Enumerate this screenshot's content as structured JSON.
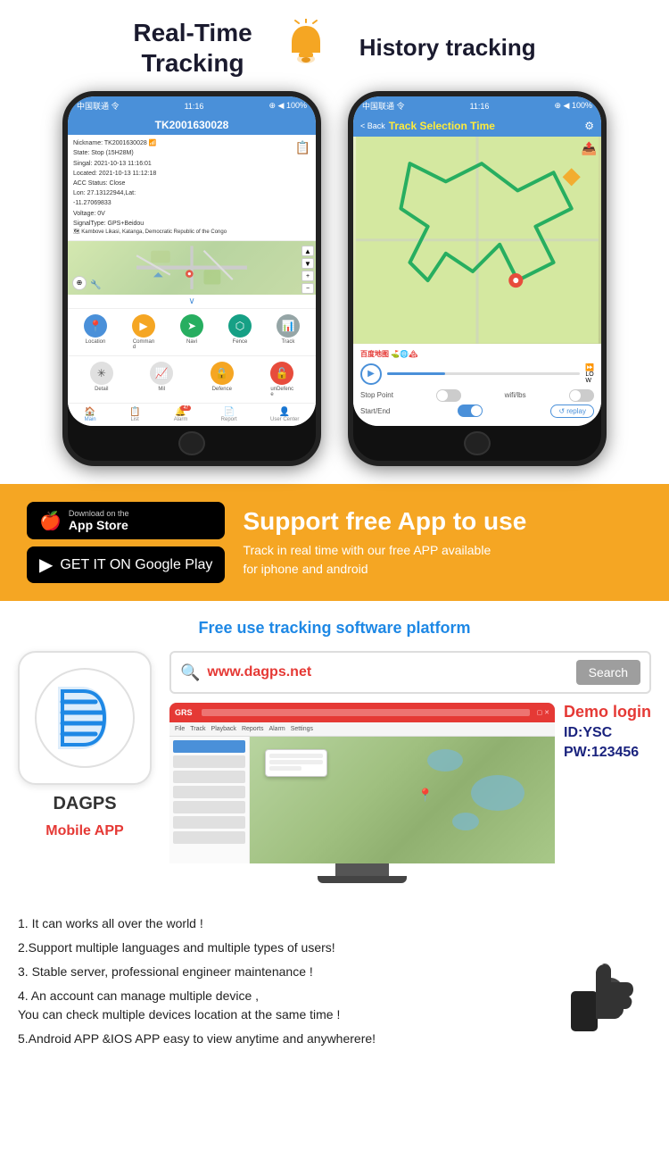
{
  "header": {
    "real_time_tracking": "Real-Time\nTracking",
    "history_tracking": "History tracking"
  },
  "left_phone": {
    "status_bar_left": "中国联通 令",
    "status_bar_time": "11:16",
    "status_bar_right": "⊕ ◀ 100%",
    "header_title": "TK2001630028",
    "info_lines": [
      "Nickname: TK2001630028",
      "State: Stop (15H28M)",
      "Singal: 2021-10-13 11:16:01",
      "Located: 2021-10-13 11:12:18",
      "ACC Status: Close",
      "Lon: 27.13122944,Lat:",
      "-11.27069833",
      "Voltage: 0V",
      "SignalType: GPS+Beidou"
    ],
    "map_location": "Kambove Likasi, Katanga,\nDemocratic Republic of the Congo",
    "buttons_row1": [
      {
        "label": "Location",
        "color": "blue"
      },
      {
        "label": "Command",
        "color": "orange"
      },
      {
        "label": "Navi",
        "color": "green"
      },
      {
        "label": "Fence",
        "color": "teal"
      },
      {
        "label": "Track",
        "color": "gray"
      }
    ],
    "buttons_row2": [
      {
        "label": "Detail",
        "color": "blue-outline"
      },
      {
        "label": "Mil",
        "color": "green-outline"
      },
      {
        "label": "Defence",
        "color": "orange"
      },
      {
        "label": "unDefence",
        "color": "red"
      }
    ],
    "tabs": [
      {
        "label": "Main",
        "active": true
      },
      {
        "label": "List",
        "active": false
      },
      {
        "label": "Alarm",
        "badge": "47",
        "active": false
      },
      {
        "label": "Report",
        "active": false
      },
      {
        "label": "User Center",
        "active": false
      }
    ]
  },
  "right_phone": {
    "status_bar_left": "中国联通 令",
    "status_bar_time": "11:16",
    "status_bar_right": "⊕ ◀ 100%",
    "back_label": "< Back",
    "title_part1": "Track",
    "title_part2": " Selection Time",
    "controls": {
      "stop_point": "Stop Point",
      "wifi_lbs": "wifi/lbs",
      "start_end": "Start/End",
      "replay": "↺ replay",
      "speed_label": "LO\nW"
    }
  },
  "yellow_section": {
    "app_store_top": "Download on the",
    "app_store_bottom": "App Store",
    "google_play_top": "GET IT ON",
    "google_play_bottom": "Google Play",
    "support_title": "Support free App to use",
    "support_desc": "Track in real time with our free APP available\nfor iphone and android"
  },
  "platform_section": {
    "title": "Free use tracking software platform",
    "url": "www.dagps.net",
    "search_placeholder": "Search",
    "app_name": "DAGPS",
    "mobile_app_label": "Mobile APP",
    "demo_login": "Demo login",
    "demo_id": "ID:YSC",
    "demo_pw": "PW:123456"
  },
  "features": {
    "items": [
      "1. It can works all over the world !",
      "2.Support multiple languages and multiple types of users!",
      "3. Stable server, professional engineer maintenance !",
      "4. An account can manage multiple device ,\nYou can check multiple devices location at the same time !",
      "5.Android APP &IOS APP easy to view anytime and anywherere!"
    ]
  }
}
